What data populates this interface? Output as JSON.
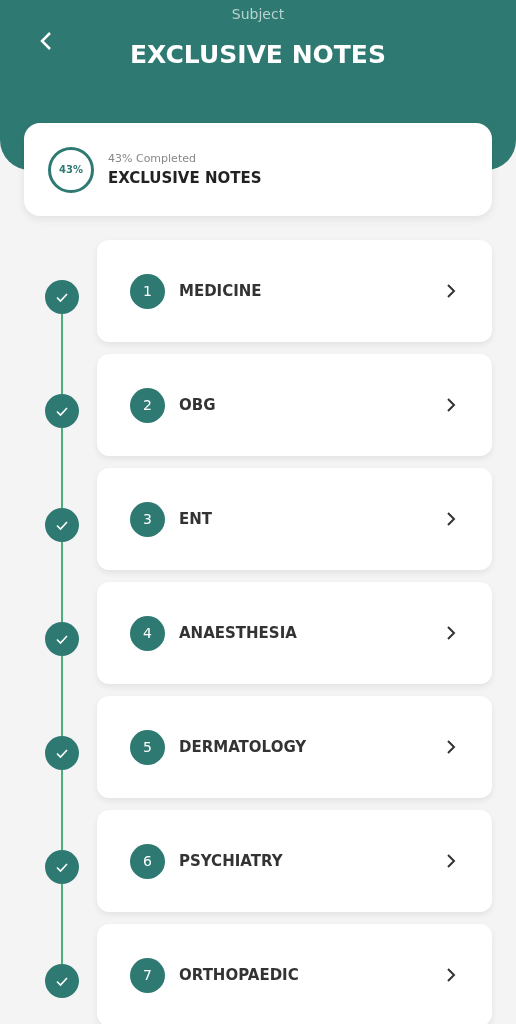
{
  "header": {
    "subtitle": "Subject",
    "title": "EXCLUSIVE NOTES"
  },
  "summary": {
    "percent": "43%",
    "caption": "43% Completed",
    "title": "EXCLUSIVE NOTES"
  },
  "chapters": [
    {
      "number": "1",
      "name": "MEDICINE",
      "completed": true
    },
    {
      "number": "2",
      "name": "OBG",
      "completed": true
    },
    {
      "number": "3",
      "name": "ENT",
      "completed": true
    },
    {
      "number": "4",
      "name": "ANAESTHESIA",
      "completed": true
    },
    {
      "number": "5",
      "name": "DERMATOLOGY",
      "completed": true
    },
    {
      "number": "6",
      "name": "PSYCHIATRY",
      "completed": true
    },
    {
      "number": "7",
      "name": "ORTHOPAEDIC",
      "completed": true
    }
  ]
}
